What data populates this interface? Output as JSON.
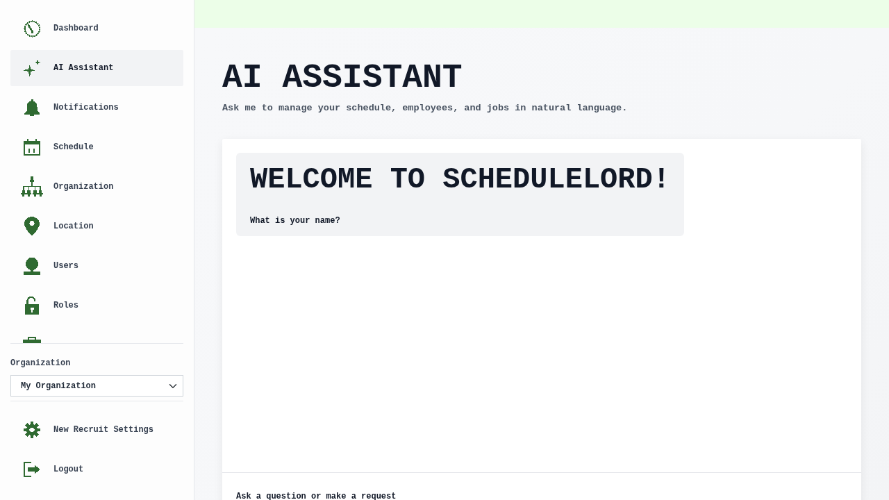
{
  "sidebar": {
    "nav_items": [
      {
        "label": "Dashboard",
        "selected": false
      },
      {
        "label": "AI Assistant",
        "selected": true
      },
      {
        "label": "Notifications",
        "selected": false
      },
      {
        "label": "Schedule",
        "selected": false
      },
      {
        "label": "Organization",
        "selected": false
      },
      {
        "label": "Location",
        "selected": false
      },
      {
        "label": "Users",
        "selected": false
      },
      {
        "label": "Roles",
        "selected": false
      }
    ],
    "organization_select": {
      "label": "Organization",
      "value": "My Organization"
    },
    "bottom_items": [
      {
        "label": "New Recruit Settings"
      },
      {
        "label": "Logout"
      }
    ]
  },
  "page": {
    "title": "AI ASSISTANT",
    "subtitle": "Ask me to manage your schedule, employees, and jobs in natural language."
  },
  "chat": {
    "messages": [
      {
        "kind": "assistant",
        "heading": "WELCOME TO SCHEDULELORD!",
        "text": "What is your name?"
      }
    ],
    "input_label": "Ask a question or make a request"
  }
}
